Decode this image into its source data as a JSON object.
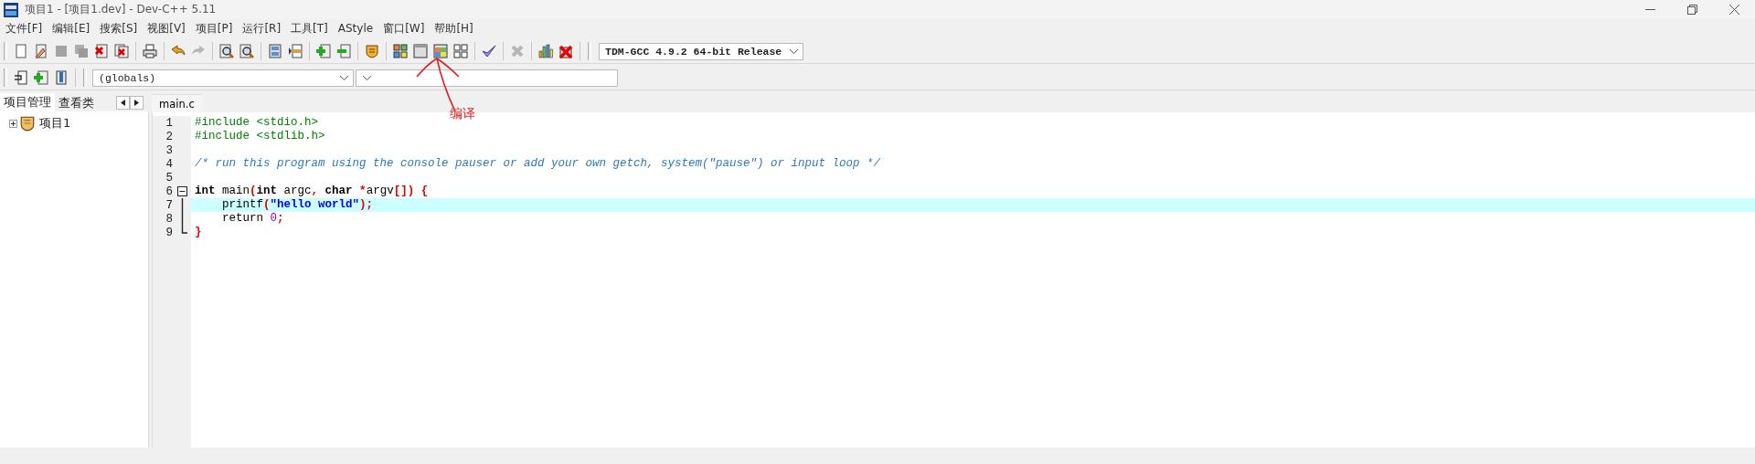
{
  "window": {
    "title": "项目1 - [项目1.dev] - Dev-C++ 5.11"
  },
  "menu": [
    "文件[F]",
    "编辑[E]",
    "搜索[S]",
    "视图[V]",
    "项目[P]",
    "运行[R]",
    "工具[T]",
    "AStyle",
    "窗口[W]",
    "帮助[H]"
  ],
  "main_toolbar": {
    "groups": [
      [
        {
          "kind": "new",
          "disabled": false
        },
        {
          "kind": "open",
          "disabled": false
        },
        {
          "kind": "save",
          "disabled": true
        },
        {
          "kind": "save-all",
          "disabled": true
        },
        {
          "kind": "close",
          "disabled": false
        },
        {
          "kind": "close-all",
          "disabled": false
        }
      ],
      [
        {
          "kind": "print",
          "disabled": false
        }
      ],
      [
        {
          "kind": "undo",
          "disabled": false
        },
        {
          "kind": "redo",
          "disabled": true
        }
      ],
      [
        {
          "kind": "find",
          "disabled": false
        },
        {
          "kind": "find-replace",
          "disabled": false
        }
      ],
      [
        {
          "kind": "panel",
          "disabled": false
        },
        {
          "kind": "split",
          "disabled": false
        }
      ],
      [
        {
          "kind": "add",
          "disabled": false
        },
        {
          "kind": "remove",
          "disabled": false
        }
      ],
      [
        {
          "kind": "shield",
          "disabled": false
        }
      ],
      [
        {
          "kind": "compile",
          "disabled": false
        },
        {
          "kind": "run",
          "disabled": false
        },
        {
          "kind": "compile-run",
          "disabled": false
        },
        {
          "kind": "rebuild",
          "disabled": false
        }
      ],
      [
        {
          "kind": "check",
          "disabled": false
        }
      ],
      [
        {
          "kind": "stop",
          "disabled": true
        }
      ],
      [
        {
          "kind": "chart",
          "disabled": false
        },
        {
          "kind": "debug-stop",
          "disabled": false
        }
      ]
    ],
    "compiler": "TDM-GCC 4.9.2 64-bit Release"
  },
  "second_toolbar": {
    "buttons": [
      {
        "kind": "goto",
        "disabled": false
      },
      {
        "kind": "insert",
        "disabled": false
      },
      {
        "kind": "bookmark",
        "disabled": false
      }
    ],
    "scope": "(globals)"
  },
  "annotation": {
    "text": "编译"
  },
  "left_panel": {
    "tabs": [
      {
        "label": "项目管理",
        "selected": true
      },
      {
        "label": "查看类",
        "selected": false
      }
    ],
    "tree": [
      {
        "label": "项目1",
        "expanded": false
      }
    ]
  },
  "editor": {
    "tabs": [
      {
        "label": "main.c",
        "selected": true
      }
    ],
    "lines": [
      {
        "number": "1",
        "kind": "plain",
        "highlighted": false,
        "tokens": [
          {
            "kind": "preprocessor",
            "text": "#include <stdio.h>"
          }
        ]
      },
      {
        "number": "2",
        "kind": "plain",
        "highlighted": false,
        "tokens": [
          {
            "kind": "preprocessor",
            "text": "#include <stdlib.h>"
          }
        ]
      },
      {
        "number": "3",
        "kind": "plain",
        "highlighted": false
      },
      {
        "number": "4",
        "kind": "plain",
        "highlighted": false,
        "tokens": [
          {
            "kind": "comment",
            "text": "/* run this program using the console pauser or add your own getch, system(\"pause\") or input loop */"
          }
        ]
      },
      {
        "number": "5",
        "kind": "plain",
        "highlighted": false
      },
      {
        "number": "6",
        "kind": "fold-start",
        "highlighted": false,
        "tokens": [
          {
            "kind": "keyword",
            "text": "int"
          },
          {
            "kind": "plain",
            "text": " main"
          },
          {
            "kind": "symbol",
            "text": "("
          },
          {
            "kind": "keyword",
            "text": "int"
          },
          {
            "kind": "plain",
            "text": " argc"
          },
          {
            "kind": "symbol",
            "text": ","
          },
          {
            "kind": "keyword",
            "text": " char"
          },
          {
            "kind": "symbol",
            "text": " *"
          },
          {
            "kind": "plain",
            "text": "argv"
          },
          {
            "kind": "symbol",
            "text": "[]) {"
          }
        ]
      },
      {
        "number": "7",
        "kind": "fold-body",
        "highlighted": true,
        "tokens": [
          {
            "kind": "plain",
            "text": "    printf"
          },
          {
            "kind": "symbol",
            "text": "("
          },
          {
            "kind": "string",
            "text": "\"hello world\""
          },
          {
            "kind": "symbol",
            "text": ");"
          }
        ]
      },
      {
        "number": "8",
        "kind": "fold-body",
        "highlighted": false,
        "tokens": [
          {
            "kind": "plain",
            "text": "    return "
          },
          {
            "kind": "number",
            "text": "0"
          },
          {
            "kind": "symbol",
            "text": ";"
          }
        ]
      },
      {
        "number": "9",
        "kind": "fold-end",
        "highlighted": false,
        "tokens": [
          {
            "kind": "symbol",
            "text": "}"
          }
        ]
      }
    ]
  }
}
